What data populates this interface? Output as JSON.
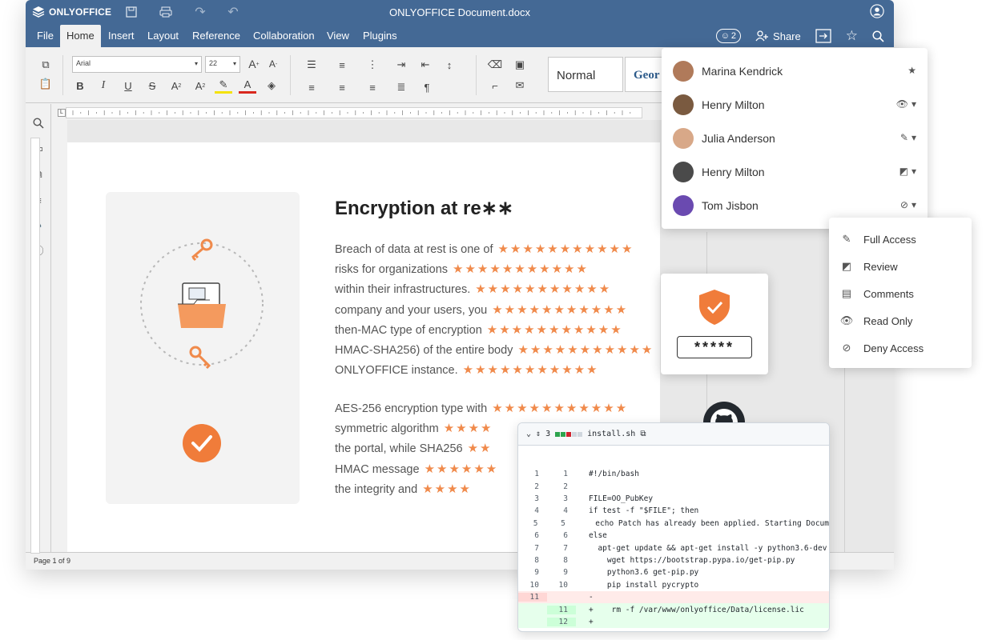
{
  "app": {
    "logo_text": "ONLYOFFICE",
    "document_title": "ONLYOFFICE Document.docx"
  },
  "tabs": [
    {
      "label": "File"
    },
    {
      "label": "Home",
      "active": true
    },
    {
      "label": "Insert"
    },
    {
      "label": "Layout"
    },
    {
      "label": "Reference"
    },
    {
      "label": "Collaboration"
    },
    {
      "label": "View"
    },
    {
      "label": "Plugins"
    }
  ],
  "header_right": {
    "users_count": "2",
    "share_label": "Share"
  },
  "toolbar": {
    "font_name": "Arial",
    "font_size": "22",
    "style_normal": "Normal",
    "style_next": "Geor"
  },
  "status": {
    "page_info": "Page 1 of 9"
  },
  "document": {
    "heading": "Encryption at re∗∗",
    "lines": [
      {
        "text": "Breach of data at rest is one of",
        "stars": "★★★★★★★★★★★"
      },
      {
        "text": "risks for organizations",
        "stars": "★★★★★★★★★★★"
      },
      {
        "text": "within their infrastructures.",
        "stars": "★★★★★★★★★★★"
      },
      {
        "text": "company and your users, you",
        "stars": "★★★★★★★★★★★"
      },
      {
        "text": "then-MAC type of encryption",
        "stars": "★★★★★★★★★★★"
      },
      {
        "text": "HMAC-SHA256) of the entire body",
        "stars": "★★★★★★★★★★★"
      },
      {
        "text": "ONLYOFFICE instance.",
        "stars": "★★★★★★★★★★★"
      },
      {
        "text": "AES-256 encryption type with",
        "stars": "★★★★★★★★★★★"
      },
      {
        "text": "symmetric algorithm",
        "stars": "★★★★"
      },
      {
        "text": "the portal, while SHA256",
        "stars": "★★"
      },
      {
        "text": "HMAC message",
        "stars": "★★★★★★"
      },
      {
        "text": "the integrity and",
        "stars": "★★★★"
      }
    ]
  },
  "sharing": {
    "users": [
      {
        "name": "Marina Kendrick",
        "permission_icon": "star-icon",
        "avatar_color": "#b07a5a"
      },
      {
        "name": "Henry Milton",
        "permission_icon": "eye-icon",
        "avatar_color": "#7a5a40"
      },
      {
        "name": "Julia Anderson",
        "permission_icon": "pencil-icon",
        "avatar_color": "#d8a888"
      },
      {
        "name": "Henry Milton",
        "permission_icon": "review-icon",
        "avatar_color": "#4a4a4a"
      },
      {
        "name": "Tom Jisbon",
        "permission_icon": "deny-icon",
        "avatar_color": "#6a4ab0"
      }
    ]
  },
  "access_menu": {
    "items": [
      {
        "label": "Full Access",
        "icon": "pencil-icon"
      },
      {
        "label": "Review",
        "icon": "review-icon"
      },
      {
        "label": "Comments",
        "icon": "comment-icon"
      },
      {
        "label": "Read Only",
        "icon": "eye-icon"
      },
      {
        "label": "Deny Access",
        "icon": "deny-icon"
      }
    ]
  },
  "password": {
    "mask": "*****"
  },
  "diff": {
    "changes": "3",
    "filename": "install.sh",
    "lines": [
      {
        "old": "1",
        "new": "1",
        "type": "ctx",
        "code": "#!/bin/bash"
      },
      {
        "old": "2",
        "new": "2",
        "type": "ctx",
        "code": ""
      },
      {
        "old": "3",
        "new": "3",
        "type": "ctx",
        "code": "FILE=OO_PubKey"
      },
      {
        "old": "4",
        "new": "4",
        "type": "ctx",
        "code": "if test -f \"$FILE\"; then"
      },
      {
        "old": "5",
        "new": "5",
        "type": "ctx",
        "code": "  echo Patch has already been applied. Starting Docum"
      },
      {
        "old": "6",
        "new": "6",
        "type": "ctx",
        "code": "else"
      },
      {
        "old": "7",
        "new": "7",
        "type": "ctx",
        "code": "  apt-get update && apt-get install -y python3.6-dev"
      },
      {
        "old": "8",
        "new": "8",
        "type": "ctx",
        "code": "    wget https://bootstrap.pypa.io/get-pip.py"
      },
      {
        "old": "9",
        "new": "9",
        "type": "ctx",
        "code": "    python3.6 get-pip.py"
      },
      {
        "old": "10",
        "new": "10",
        "type": "ctx",
        "code": "    pip install pycrypto"
      },
      {
        "old": "11",
        "new": "",
        "type": "del",
        "code": "-"
      },
      {
        "old": "",
        "new": "11",
        "type": "add",
        "code": "+    rm -f /var/www/onlyoffice/Data/license.lic"
      },
      {
        "old": "",
        "new": "12",
        "type": "add",
        "code": "+"
      }
    ]
  },
  "colors": {
    "header": "#446995",
    "accent_orange": "#f08a4b"
  }
}
